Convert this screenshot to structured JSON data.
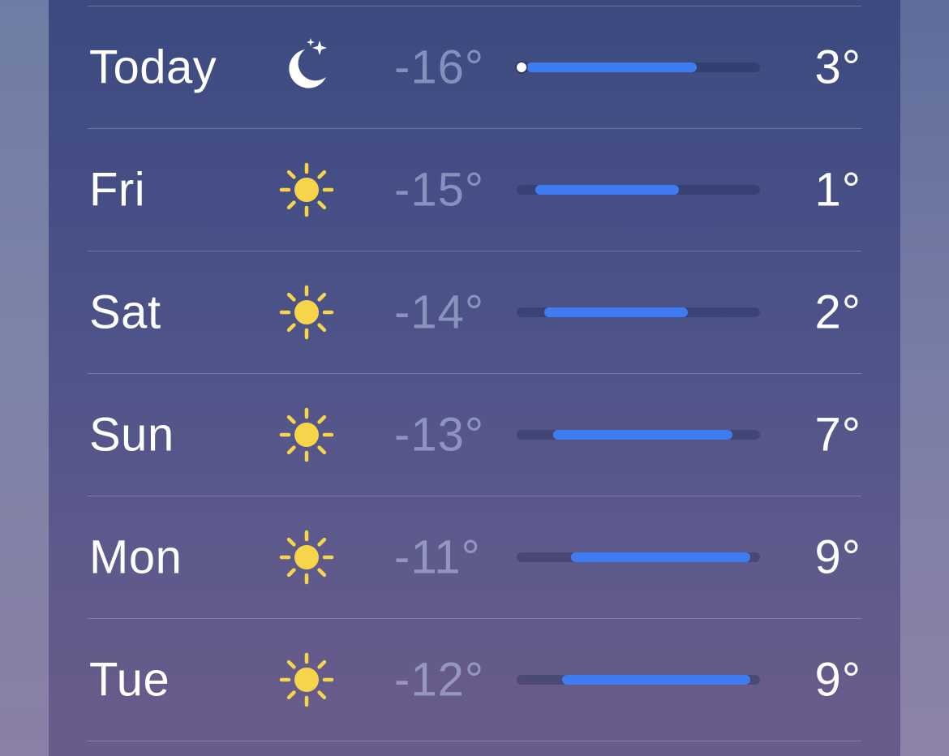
{
  "forecast": {
    "scale": {
      "min": -16,
      "max": 9
    },
    "current_temp": -16,
    "days": [
      {
        "day": "Today",
        "icon": "moon-stars-icon",
        "low": "-16°",
        "high": "3°",
        "low_value": -16,
        "high_value": 3
      },
      {
        "day": "Fri",
        "icon": "sun-icon",
        "low": "-15°",
        "high": "1°",
        "low_value": -15,
        "high_value": 1
      },
      {
        "day": "Sat",
        "icon": "sun-icon",
        "low": "-14°",
        "high": "2°",
        "low_value": -14,
        "high_value": 2
      },
      {
        "day": "Sun",
        "icon": "sun-icon",
        "low": "-13°",
        "high": "7°",
        "low_value": -13,
        "high_value": 7
      },
      {
        "day": "Mon",
        "icon": "sun-icon",
        "low": "-11°",
        "high": "9°",
        "low_value": -11,
        "high_value": 9
      },
      {
        "day": "Tue",
        "icon": "sun-icon",
        "low": "-12°",
        "high": "9°",
        "low_value": -12,
        "high_value": 9
      }
    ]
  },
  "colors": {
    "bar_fill": "#3f7cf1",
    "sun": "#f7d54a",
    "moon": "#ffffff"
  }
}
